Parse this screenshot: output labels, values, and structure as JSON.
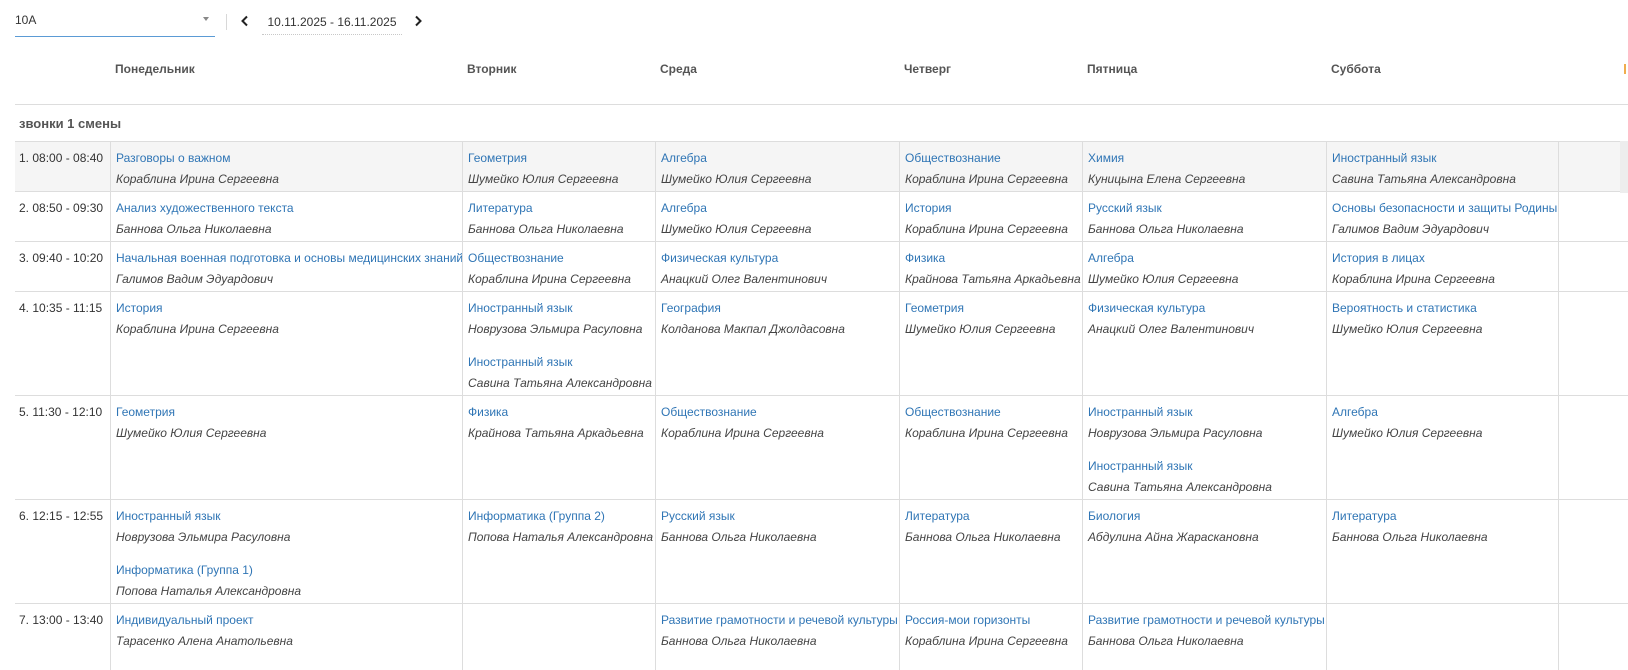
{
  "toolbar": {
    "class_value": "10А",
    "date_range": "10.11.2025 - 16.11.2025",
    "prev_icon": "chevron-left-icon",
    "next_icon": "chevron-right-icon"
  },
  "days": [
    "Понедельник",
    "Вторник",
    "Среда",
    "Четверг",
    "Пятница",
    "Суббота"
  ],
  "shift_title": "звонки 1 смены",
  "colors": {
    "link": "#2f75b5",
    "border": "#dddddd",
    "first_row_bg": "#f5f5f5",
    "accent_underline": "#5b9bd5"
  },
  "periods": [
    {
      "time": "1. 08:00 - 08:40",
      "cells": [
        [
          {
            "subject": "Разговоры о важном",
            "teacher": "Кораблина Ирина Сергеевна"
          }
        ],
        [
          {
            "subject": "Геометрия",
            "teacher": "Шумейко Юлия Сергеевна"
          }
        ],
        [
          {
            "subject": "Алгебра",
            "teacher": "Шумейко Юлия Сергеевна"
          }
        ],
        [
          {
            "subject": "Обществознание",
            "teacher": "Кораблина Ирина Сергеевна"
          }
        ],
        [
          {
            "subject": "Химия",
            "teacher": "Куницына Елена Сергеевна"
          }
        ],
        [
          {
            "subject": "Иностранный язык",
            "teacher": "Савина Татьяна Александровна"
          }
        ]
      ]
    },
    {
      "time": "2. 08:50 - 09:30",
      "cells": [
        [
          {
            "subject": "Анализ художественного текста",
            "teacher": "Баннова Ольга Николаевна"
          }
        ],
        [
          {
            "subject": "Литература",
            "teacher": "Баннова Ольга Николаевна"
          }
        ],
        [
          {
            "subject": "Алгебра",
            "teacher": "Шумейко Юлия Сергеевна"
          }
        ],
        [
          {
            "subject": "История",
            "teacher": "Кораблина Ирина Сергеевна"
          }
        ],
        [
          {
            "subject": "Русский язык",
            "teacher": "Баннова Ольга Николаевна"
          }
        ],
        [
          {
            "subject": "Основы безопасности и защиты Родины",
            "teacher": "Галимов Вадим Эдуардович"
          }
        ]
      ]
    },
    {
      "time": "3. 09:40 - 10:20",
      "cells": [
        [
          {
            "subject": "Начальная военная подготовка и основы медицинских знаний",
            "teacher": "Галимов Вадим Эдуардович"
          }
        ],
        [
          {
            "subject": "Обществознание",
            "teacher": "Кораблина Ирина Сергеевна"
          }
        ],
        [
          {
            "subject": "Физическая культура",
            "teacher": "Анацкий Олег Валентинович"
          }
        ],
        [
          {
            "subject": "Физика",
            "teacher": "Крайнова Татьяна Аркадьевна"
          }
        ],
        [
          {
            "subject": "Алгебра",
            "teacher": "Шумейко Юлия Сергеевна"
          }
        ],
        [
          {
            "subject": "История в лицах",
            "teacher": "Кораблина Ирина Сергеевна"
          }
        ]
      ]
    },
    {
      "time": "4. 10:35 - 11:15",
      "cells": [
        [
          {
            "subject": "История",
            "teacher": "Кораблина Ирина Сергеевна"
          }
        ],
        [
          {
            "subject": "Иностранный язык",
            "teacher": "Новрузова Эльмира Расуловна"
          },
          {
            "subject": "Иностранный язык",
            "teacher": "Савина Татьяна Александровна"
          }
        ],
        [
          {
            "subject": "География",
            "teacher": "Колданова Макпал Джолдасовна"
          }
        ],
        [
          {
            "subject": "Геометрия",
            "teacher": "Шумейко Юлия Сергеевна"
          }
        ],
        [
          {
            "subject": "Физическая культура",
            "teacher": "Анацкий Олег Валентинович"
          }
        ],
        [
          {
            "subject": "Вероятность и статистика",
            "teacher": "Шумейко Юлия Сергеевна"
          }
        ]
      ]
    },
    {
      "time": "5. 11:30 - 12:10",
      "cells": [
        [
          {
            "subject": "Геометрия",
            "teacher": "Шумейко Юлия Сергеевна"
          }
        ],
        [
          {
            "subject": "Физика",
            "teacher": "Крайнова Татьяна Аркадьевна"
          }
        ],
        [
          {
            "subject": "Обществознание",
            "teacher": "Кораблина Ирина Сергеевна"
          }
        ],
        [
          {
            "subject": "Обществознание",
            "teacher": "Кораблина Ирина Сергеевна"
          }
        ],
        [
          {
            "subject": "Иностранный язык",
            "teacher": "Новрузова Эльмира Расуловна"
          },
          {
            "subject": "Иностранный язык",
            "teacher": "Савина Татьяна Александровна"
          }
        ],
        [
          {
            "subject": "Алгебра",
            "teacher": "Шумейко Юлия Сергеевна"
          }
        ]
      ]
    },
    {
      "time": "6. 12:15 - 12:55",
      "cells": [
        [
          {
            "subject": "Иностранный язык",
            "teacher": "Новрузова Эльмира Расуловна"
          },
          {
            "subject": "Информатика (Группа 1)",
            "teacher": "Попова Наталья Александровна"
          }
        ],
        [
          {
            "subject": "Информатика (Группа 2)",
            "teacher": "Попова Наталья Александровна"
          }
        ],
        [
          {
            "subject": "Русский язык",
            "teacher": "Баннова Ольга Николаевна"
          }
        ],
        [
          {
            "subject": "Литература",
            "teacher": "Баннова Ольга Николаевна"
          }
        ],
        [
          {
            "subject": "Биология",
            "teacher": "Абдулина Айна Жарасканoвна"
          }
        ],
        [
          {
            "subject": "Литература",
            "teacher": "Баннова Ольга Николаевна"
          }
        ]
      ]
    },
    {
      "time": "7. 13:00 - 13:40",
      "cells": [
        [
          {
            "subject": "Индивидуальный проект",
            "teacher": "Тарасенко Алена Анатольевна"
          }
        ],
        [],
        [
          {
            "subject": "Развитие грамотности и речевой культуры",
            "teacher": "Баннова Ольга Николаевна"
          }
        ],
        [
          {
            "subject": "Россия-мои горизонты",
            "teacher": "Кораблина Ирина Сергеевна"
          }
        ],
        [
          {
            "subject": "Развитие грамотности и речевой культуры",
            "teacher": "Баннова Ольга Николаевна"
          }
        ],
        []
      ]
    }
  ]
}
